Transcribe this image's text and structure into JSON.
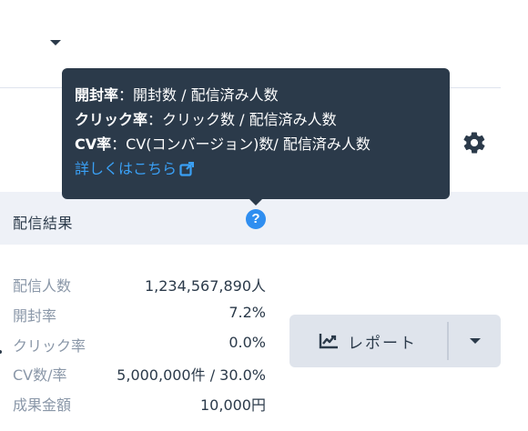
{
  "tooltip": {
    "open_rate_term": "開封率",
    "open_rate_desc": "：開封数 / 配信済み人数",
    "ctr_term": "クリック率",
    "ctr_desc": "：クリック数 / 配信済み人数",
    "cvr_term": "CV率",
    "cvr_desc": "：CV(コンバージョン)数/ 配信済み人数",
    "link_label": "詳しくはこちら"
  },
  "section": {
    "title": "配信結果"
  },
  "stats": [
    {
      "label": "配信人数",
      "value": "1,234,567,890人"
    },
    {
      "label": "開封率",
      "value": "7.2%"
    },
    {
      "label": "クリック率",
      "value": "0.0%"
    },
    {
      "label": "CV数/率",
      "value": "5,000,000件 / 30.0%"
    },
    {
      "label": "成果金額",
      "value": "10,000円"
    }
  ],
  "report_button": {
    "label": "レポート"
  },
  "colors": {
    "tooltip_bg": "#2b3a4a",
    "link": "#3aa0f5",
    "help_icon": "#2f8ef0",
    "header_bg": "#eef1f7",
    "button_bg": "#dfe4ec"
  },
  "icons": {
    "help": "question-circle-icon",
    "settings": "gear-icon",
    "report": "line-chart-icon",
    "external": "external-link-icon"
  }
}
